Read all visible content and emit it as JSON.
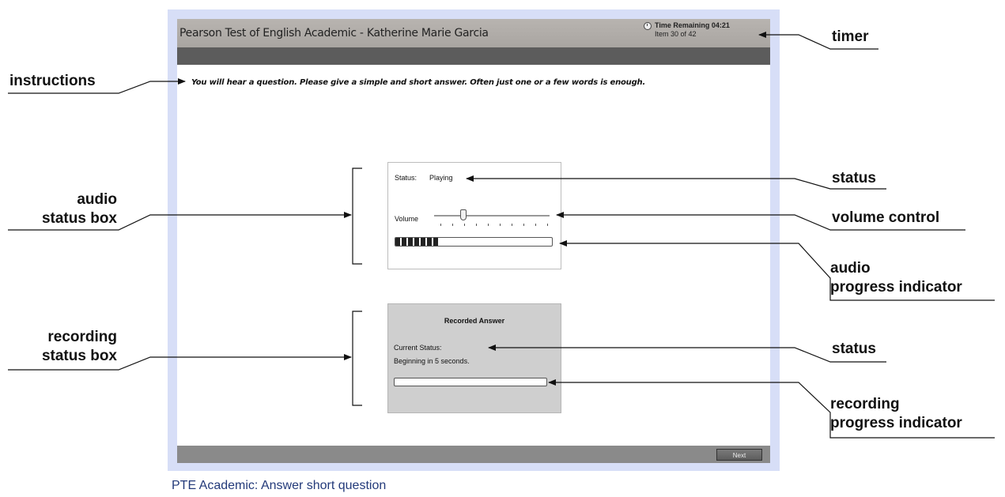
{
  "screen": {
    "title": "Pearson Test of English Academic - Katherine Marie Garcia",
    "timer": "Time Remaining 04:21",
    "item": "Item 30 of 42",
    "instructions": "You will hear a question. Please give a simple and short answer. Often just one or a few words is enough.",
    "audio": {
      "status_label": "Status:",
      "status_value": "Playing",
      "volume_label": "Volume",
      "volume_level": 0.25,
      "progress": 0.28
    },
    "recording": {
      "title": "Recorded Answer",
      "current_status_label": "Current Status:",
      "status_message": "Beginning in 5 seconds.",
      "progress": 0
    },
    "next_label": "Next"
  },
  "callouts": {
    "instructions": "instructions",
    "timer": "timer",
    "audio_box": [
      "audio",
      "status box"
    ],
    "audio_status": "status",
    "volume": "volume control",
    "audio_progress": [
      "audio",
      "progress indicator"
    ],
    "recording_box": [
      "recording",
      "status box"
    ],
    "recording_status": "status",
    "recording_progress": [
      "recording",
      "progress indicator"
    ]
  },
  "caption": "PTE Academic: Answer short question"
}
